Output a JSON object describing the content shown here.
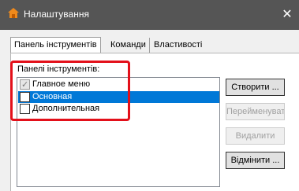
{
  "window": {
    "title": "Налаштування",
    "icon": "home-icon",
    "close_glyph": "✕"
  },
  "tabs": [
    {
      "label": "Панель інструментів",
      "active": true
    },
    {
      "label": "Команди",
      "active": false
    },
    {
      "label": "Властивості",
      "active": false
    }
  ],
  "toolbars_panel": {
    "label": "Панелі інструментів:",
    "items": [
      {
        "label": "Главное меню",
        "checked": true,
        "disabled": true,
        "selected": false
      },
      {
        "label": "Основная",
        "checked": false,
        "disabled": false,
        "selected": true
      },
      {
        "label": "Дополнительная",
        "checked": false,
        "disabled": false,
        "selected": false
      }
    ]
  },
  "buttons": {
    "create": "Створити ...",
    "rename": "Перейменувати",
    "delete": "Видалити",
    "cancel": "Відмінити ..."
  },
  "colors": {
    "titlebar": "#555555",
    "selection": "#0078d7",
    "highlight": "#e3101a"
  }
}
